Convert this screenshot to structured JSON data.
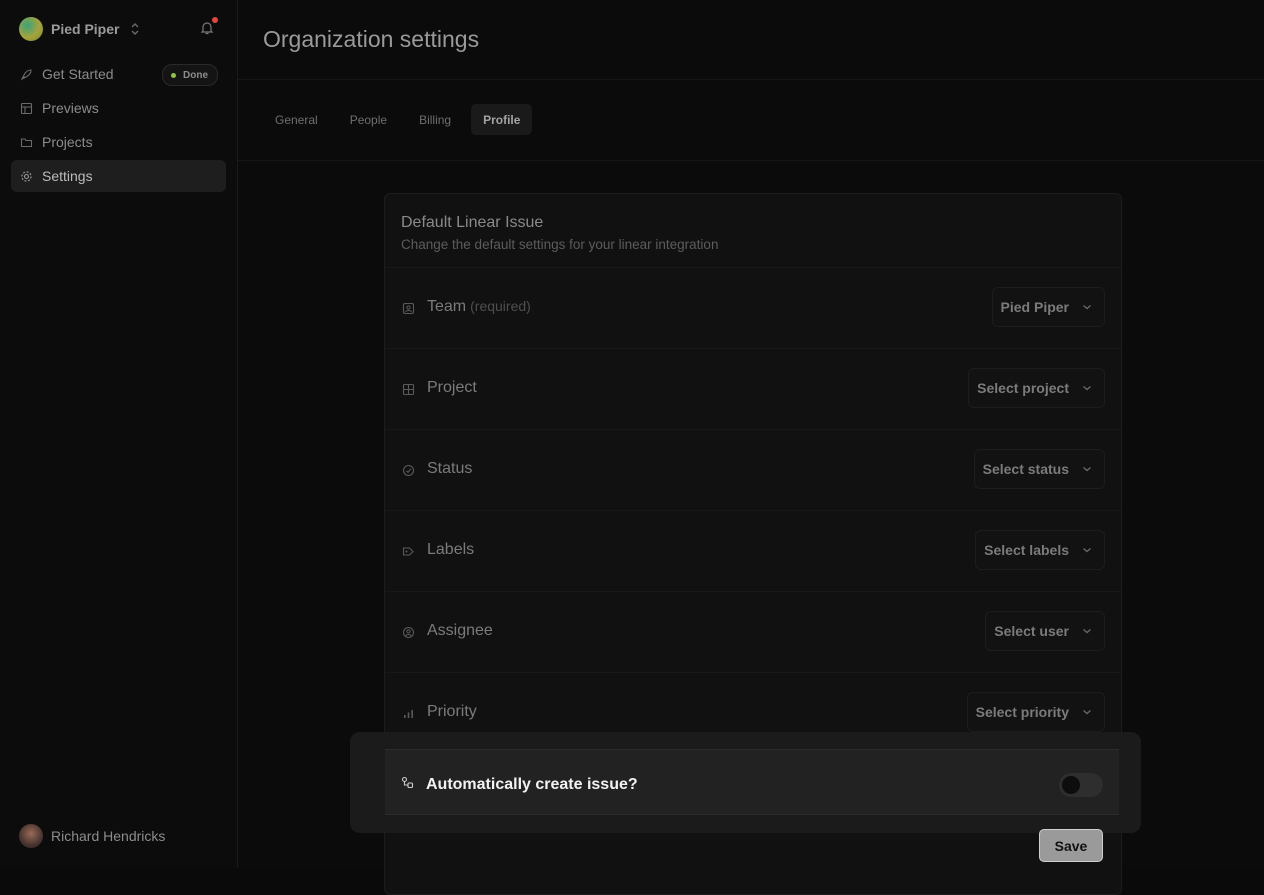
{
  "sidebar": {
    "org_name": "Pied Piper",
    "items": [
      {
        "label": "Get Started",
        "icon": "rocket-icon",
        "badge": "Done"
      },
      {
        "label": "Previews",
        "icon": "previews-icon"
      },
      {
        "label": "Projects",
        "icon": "folder-icon"
      },
      {
        "label": "Settings",
        "icon": "gear-icon",
        "active": true
      }
    ],
    "user_name": "Richard Hendricks"
  },
  "header": {
    "title": "Organization settings"
  },
  "tabs": [
    {
      "label": "General"
    },
    {
      "label": "People"
    },
    {
      "label": "Billing"
    },
    {
      "label": "Profile",
      "active": true
    }
  ],
  "card": {
    "title": "Default Linear Issue",
    "subtitle": "Change the default settings for your linear integration",
    "rows": [
      {
        "label": "Team",
        "note": "(required)",
        "value": "Pied Piper",
        "icon": "team-icon"
      },
      {
        "label": "Project",
        "value": "Select project",
        "icon": "grid-icon"
      },
      {
        "label": "Status",
        "value": "Select status",
        "icon": "status-icon"
      },
      {
        "label": "Labels",
        "value": "Select labels",
        "icon": "tag-icon"
      },
      {
        "label": "Assignee",
        "value": "Select user",
        "icon": "user-circle-icon"
      },
      {
        "label": "Priority",
        "value": "Select priority",
        "icon": "priority-icon"
      }
    ],
    "auto_create": {
      "label": "Automatically create issue?",
      "enabled": false,
      "icon": "link-icon"
    },
    "save_label": "Save"
  },
  "colors": {
    "notification_dot": "#e2463d",
    "done_dot": "#8ec63f"
  }
}
